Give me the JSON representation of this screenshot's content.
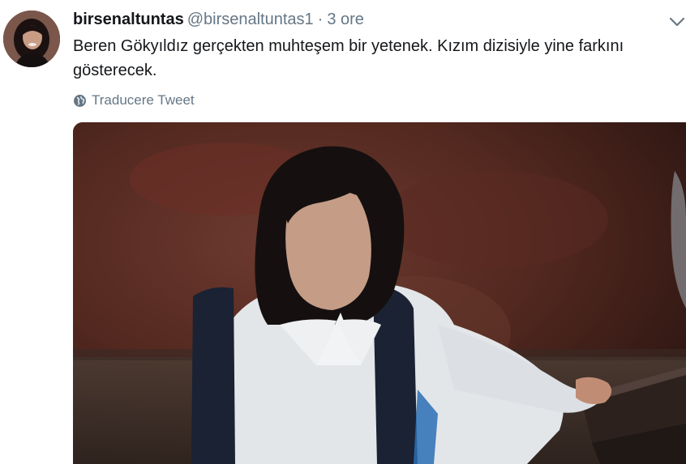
{
  "tweet": {
    "display_name": "birsenaltuntas",
    "handle": "@birsenaltuntas1",
    "separator": "·",
    "time": "3 ore",
    "text": "Beren Gökyıldız gerçekten muhteşem bir yetenek. Kızım dizisiyle yine farkını gösterecek.",
    "translate_label": "Traducere Tweet",
    "icons": {
      "more": "chevron-down-icon",
      "translate": "globe-icon"
    },
    "colors": {
      "text": "#14171a",
      "secondary": "#657786"
    }
  }
}
